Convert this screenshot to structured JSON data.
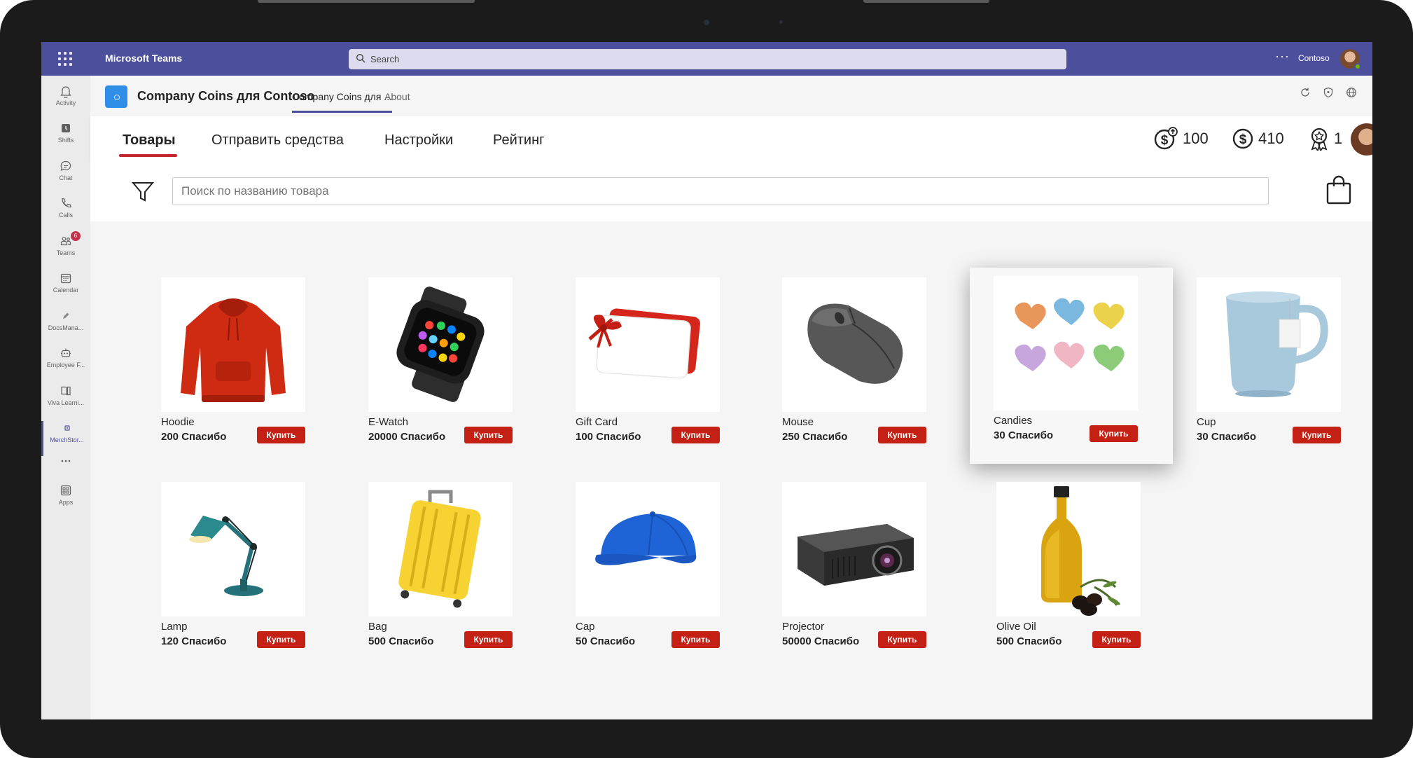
{
  "teams": {
    "app_name": "Microsoft Teams",
    "search_placeholder": "Search",
    "more_label": "···",
    "tenant": "Contoso"
  },
  "rail": [
    {
      "label": "Activity",
      "icon": "bell-icon"
    },
    {
      "label": "Shifts",
      "icon": "shifts-icon"
    },
    {
      "label": "Chat",
      "icon": "chat-icon"
    },
    {
      "label": "Calls",
      "icon": "phone-icon"
    },
    {
      "label": "Teams",
      "icon": "teams-icon",
      "badge": "6"
    },
    {
      "label": "Calendar",
      "icon": "calendar-icon"
    },
    {
      "label": "DocsMana...",
      "icon": "pen-icon"
    },
    {
      "label": "Employee F...",
      "icon": "bot-icon"
    },
    {
      "label": "Viva Learni...",
      "icon": "book-icon"
    },
    {
      "label": "MerchStor...",
      "icon": "store-icon",
      "active": true
    },
    {
      "label": "···",
      "icon": "more-icon"
    },
    {
      "label": "Apps",
      "icon": "apps-icon"
    }
  ],
  "app_header": {
    "title": "Company Coins для Contoso",
    "tabs": [
      {
        "label": "Company Coins для ...",
        "active": true
      },
      {
        "label": "About",
        "active": false
      }
    ]
  },
  "nav": {
    "items": [
      {
        "label": "Товары",
        "active": true
      },
      {
        "label": "Отправить средства",
        "active": false
      },
      {
        "label": "Настройки",
        "active": false
      },
      {
        "label": "Рейтинг",
        "active": false
      }
    ],
    "stats": [
      {
        "icon": "coin-send-icon",
        "value": "100"
      },
      {
        "icon": "dollar-coin-icon",
        "value": "410"
      },
      {
        "icon": "award-icon",
        "value": "1"
      }
    ]
  },
  "search": {
    "placeholder": "Поиск по названию товара"
  },
  "buy_label": "Купить",
  "products": [
    {
      "name": "Hoodie",
      "price": "200 Спасибо",
      "image": "hoodie"
    },
    {
      "name": "E-Watch",
      "price": "20000 Спасибо",
      "image": "watch"
    },
    {
      "name": "Gift Card",
      "price": "100 Спасибо",
      "image": "giftcard"
    },
    {
      "name": "Mouse",
      "price": "250 Спасибо",
      "image": "mouse"
    },
    {
      "name": "Candies",
      "price": "30 Спасибо",
      "image": "candies",
      "highlighted": true
    },
    {
      "name": "Cup",
      "price": "30 Спасибо",
      "image": "cup"
    },
    {
      "name": "Lamp",
      "price": "120 Спасибо",
      "image": "lamp"
    },
    {
      "name": "Bag",
      "price": "500 Спасибо",
      "image": "bag"
    },
    {
      "name": "Cap",
      "price": "50 Спасибо",
      "image": "cap"
    },
    {
      "name": "Projector",
      "price": "50000 Спасибо",
      "image": "projector"
    },
    {
      "name": "Olive Oil",
      "price": "500 Спасибо",
      "image": "oliveoil"
    }
  ],
  "colors": {
    "teams_purple": "#4b4f9c",
    "buy_red": "#c42013",
    "active_tab_underline": "#c4262e"
  }
}
